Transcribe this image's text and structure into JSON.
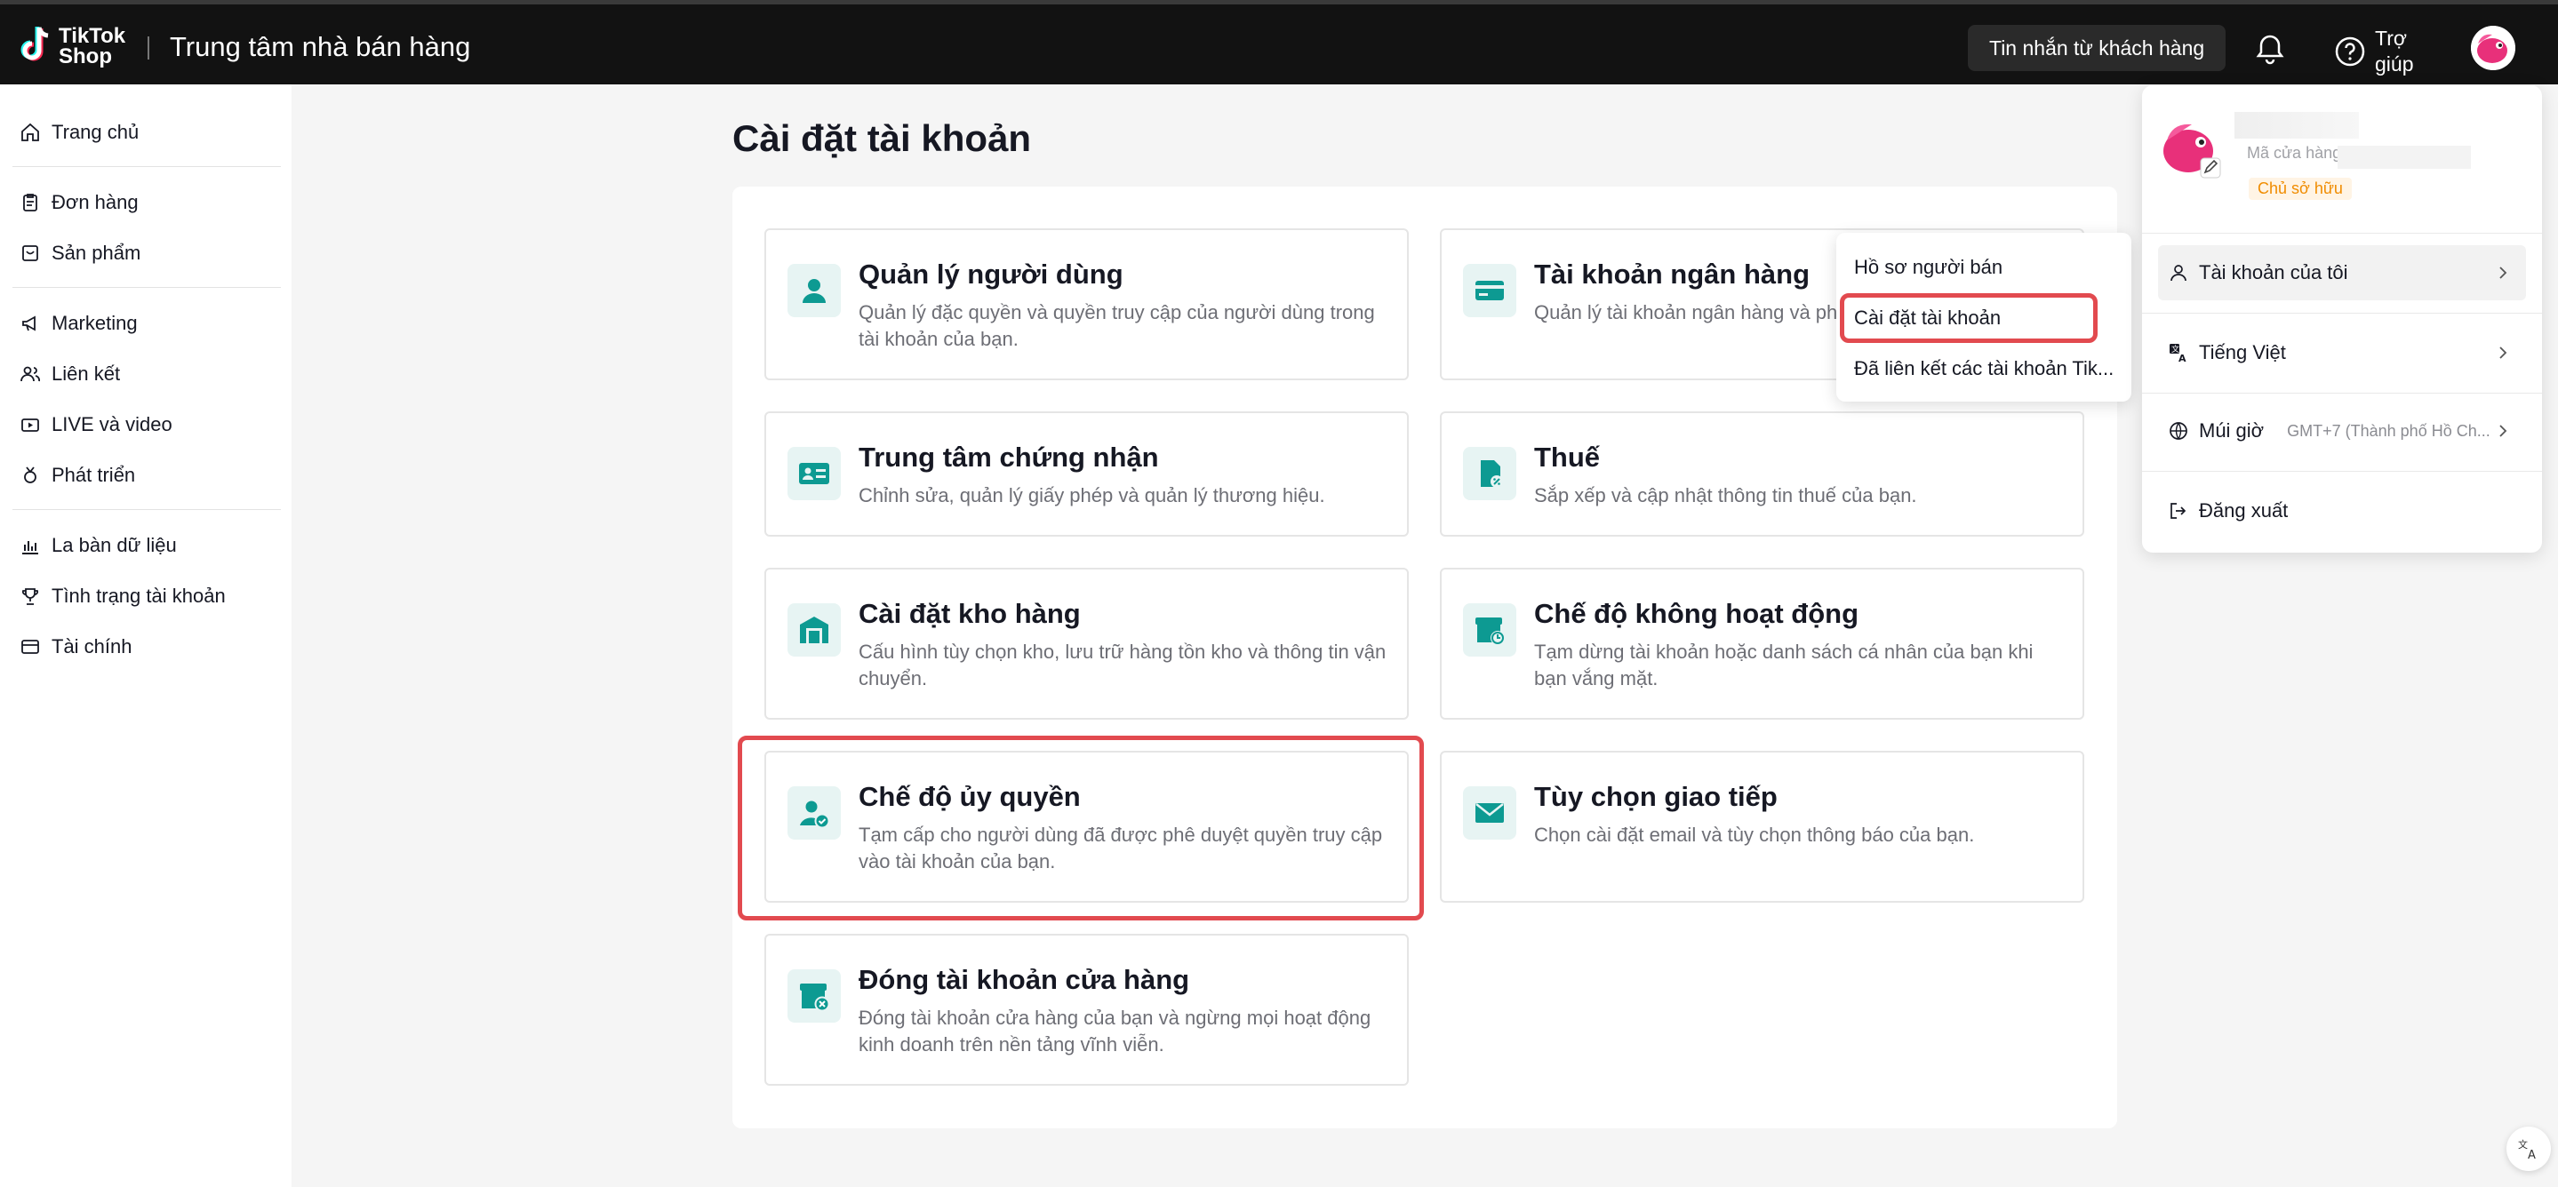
{
  "header": {
    "logo_line1": "TikTok",
    "logo_line2": "Shop",
    "app_title": "Trung tâm nhà bán hàng",
    "messages_button": "Tin nhắn từ khách hàng",
    "help_label": "Trợ giúp"
  },
  "sidebar": {
    "items": [
      {
        "label": "Trang chủ",
        "icon": "home-icon"
      },
      {
        "label": "Đơn hàng",
        "icon": "clipboard-icon"
      },
      {
        "label": "Sản phẩm",
        "icon": "product-icon"
      },
      {
        "label": "Marketing",
        "icon": "megaphone-icon"
      },
      {
        "label": "Liên kết",
        "icon": "users-icon"
      },
      {
        "label": "LIVE và video",
        "icon": "video-icon"
      },
      {
        "label": "Phát triển",
        "icon": "medal-icon"
      },
      {
        "label": "La bàn dữ liệu",
        "icon": "chart-icon"
      },
      {
        "label": "Tình trạng tài khoản",
        "icon": "trophy-icon"
      },
      {
        "label": "Tài chính",
        "icon": "wallet-icon"
      }
    ]
  },
  "main": {
    "title": "Cài đặt tài khoản",
    "cards": [
      {
        "title": "Quản lý người dùng",
        "desc": "Quản lý đặc quyền và quyền truy cập của người dùng trong tài khoản của bạn.",
        "icon": "user-icon"
      },
      {
        "title": "Tài khoản ngân hàng",
        "desc": "Quản lý tài khoản ngân hàng và phư",
        "icon": "bank-card-icon"
      },
      {
        "title": "Trung tâm chứng nhận",
        "desc": "Chỉnh sửa, quản lý giấy phép và quản lý thương hiệu.",
        "icon": "id-card-icon"
      },
      {
        "title": "Thuế",
        "desc": "Sắp xếp và cập nhật thông tin thuế của bạn.",
        "icon": "tax-icon"
      },
      {
        "title": "Cài đặt kho hàng",
        "desc": "Cấu hình tùy chọn kho, lưu trữ hàng tồn kho và thông tin vận chuyển.",
        "icon": "warehouse-icon"
      },
      {
        "title": "Chế độ không hoạt động",
        "desc": "Tạm dừng tài khoản hoặc danh sách cá nhân của bạn khi bạn vắng mặt.",
        "icon": "store-clock-icon"
      },
      {
        "title": "Chế độ ủy quyền",
        "desc": "Tạm cấp cho người dùng đã được phê duyệt quyền truy cập vào tài khoản của bạn.",
        "icon": "user-check-icon"
      },
      {
        "title": "Tùy chọn giao tiếp",
        "desc": "Chọn cài đặt email và tùy chọn thông báo của bạn.",
        "icon": "mail-icon"
      },
      {
        "title": "Đóng tài khoản cửa hàng",
        "desc": "Đóng tài khoản cửa hàng của bạn và ngừng mọi hoạt động kinh doanh trên nền tảng vĩnh viễn.",
        "icon": "store-close-icon"
      }
    ]
  },
  "dropdown": {
    "items": [
      "Hồ sơ người bán",
      "Cài đặt tài khoản",
      "Đã liên kết các tài khoản Tik..."
    ]
  },
  "account_panel": {
    "shop_code_label": "Mã cửa hàng",
    "owner_badge": "Chủ sở hữu",
    "my_account": "Tài khoản của tôi",
    "language": "Tiếng Việt",
    "timezone_label": "Múi giờ",
    "timezone_value": "GMT+7 (Thành phố Hồ Ch...",
    "logout": "Đăng xuất"
  },
  "colors": {
    "accent_teal": "#0d9a92",
    "highlight_red": "#e24a4f",
    "topbar": "#121212"
  }
}
